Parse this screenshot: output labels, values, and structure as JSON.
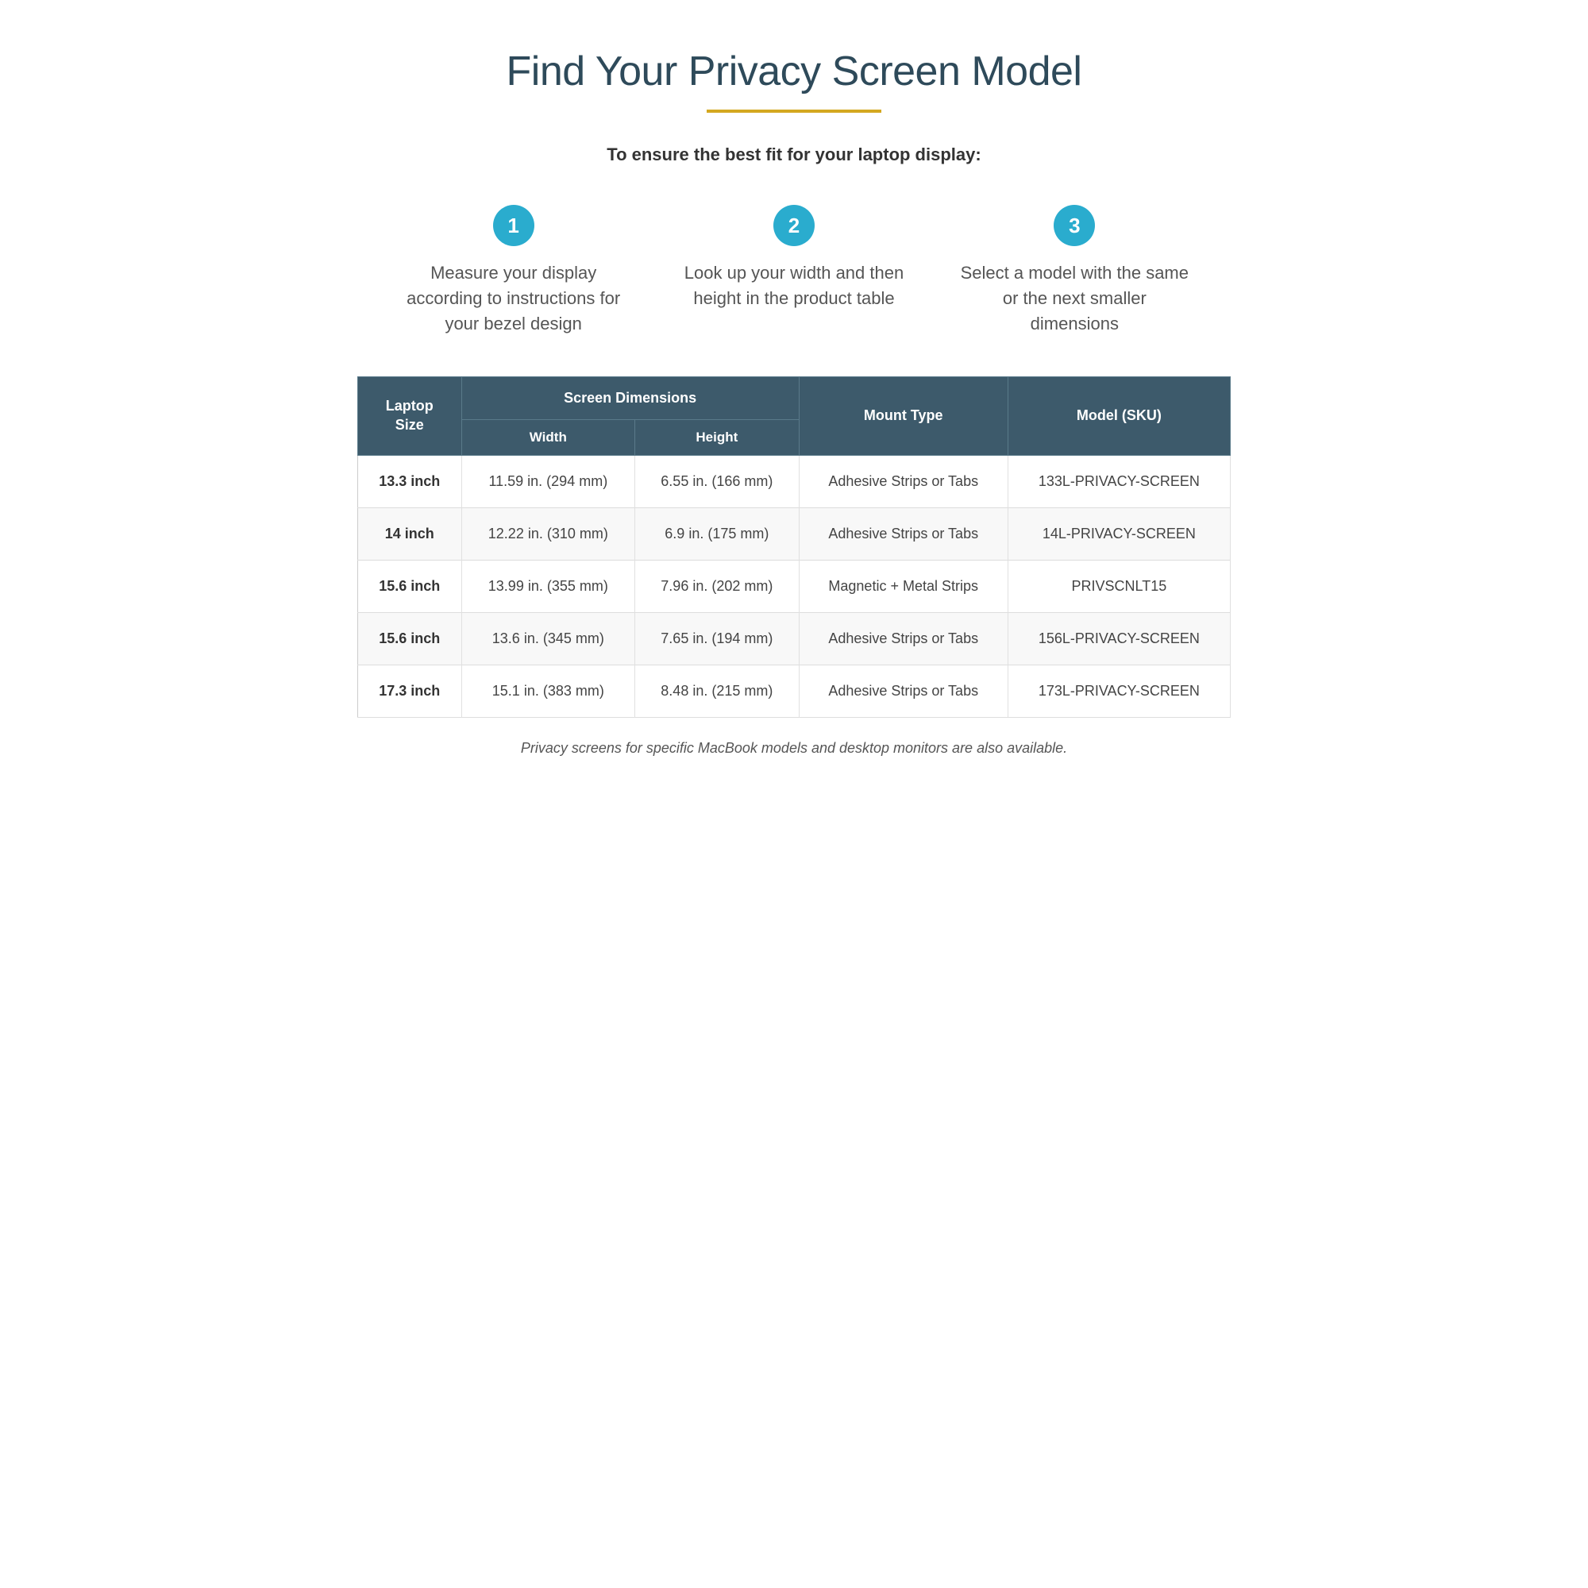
{
  "page": {
    "title": "Find Your Privacy Screen Model",
    "divider": true,
    "subtitle": "To ensure the best fit for your laptop display:",
    "steps": [
      {
        "number": "1",
        "text": "Measure your display according to instructions for your bezel design"
      },
      {
        "number": "2",
        "text": "Look up your width and then height in the product table"
      },
      {
        "number": "3",
        "text": "Select a model with the same or the next smaller dimensions"
      }
    ],
    "table": {
      "col1_header": "Laptop\nSize",
      "col_group_header": "Screen Dimensions",
      "col2_header": "Width",
      "col3_header": "Height",
      "col4_header": "Mount Type",
      "col5_header": "Model (SKU)",
      "rows": [
        {
          "laptop_size": "13.3 inch",
          "width": "11.59 in. (294 mm)",
          "height": "6.55 in. (166 mm)",
          "mount_type": "Adhesive Strips or Tabs",
          "model_sku": "133L-PRIVACY-SCREEN"
        },
        {
          "laptop_size": "14 inch",
          "width": "12.22 in. (310 mm)",
          "height": "6.9 in. (175 mm)",
          "mount_type": "Adhesive Strips or Tabs",
          "model_sku": "14L-PRIVACY-SCREEN"
        },
        {
          "laptop_size": "15.6 inch",
          "width": "13.99 in. (355 mm)",
          "height": "7.96 in. (202 mm)",
          "mount_type": "Magnetic + Metal Strips",
          "model_sku": "PRIVSCNLT15"
        },
        {
          "laptop_size": "15.6 inch",
          "width": "13.6 in. (345 mm)",
          "height": "7.65 in. (194 mm)",
          "mount_type": "Adhesive Strips or Tabs",
          "model_sku": "156L-PRIVACY-SCREEN"
        },
        {
          "laptop_size": "17.3 inch",
          "width": "15.1 in. (383 mm)",
          "height": "8.48 in. (215 mm)",
          "mount_type": "Adhesive Strips or Tabs",
          "model_sku": "173L-PRIVACY-SCREEN"
        }
      ]
    },
    "footer_note": "Privacy screens for specific MacBook models and desktop monitors are also available."
  }
}
